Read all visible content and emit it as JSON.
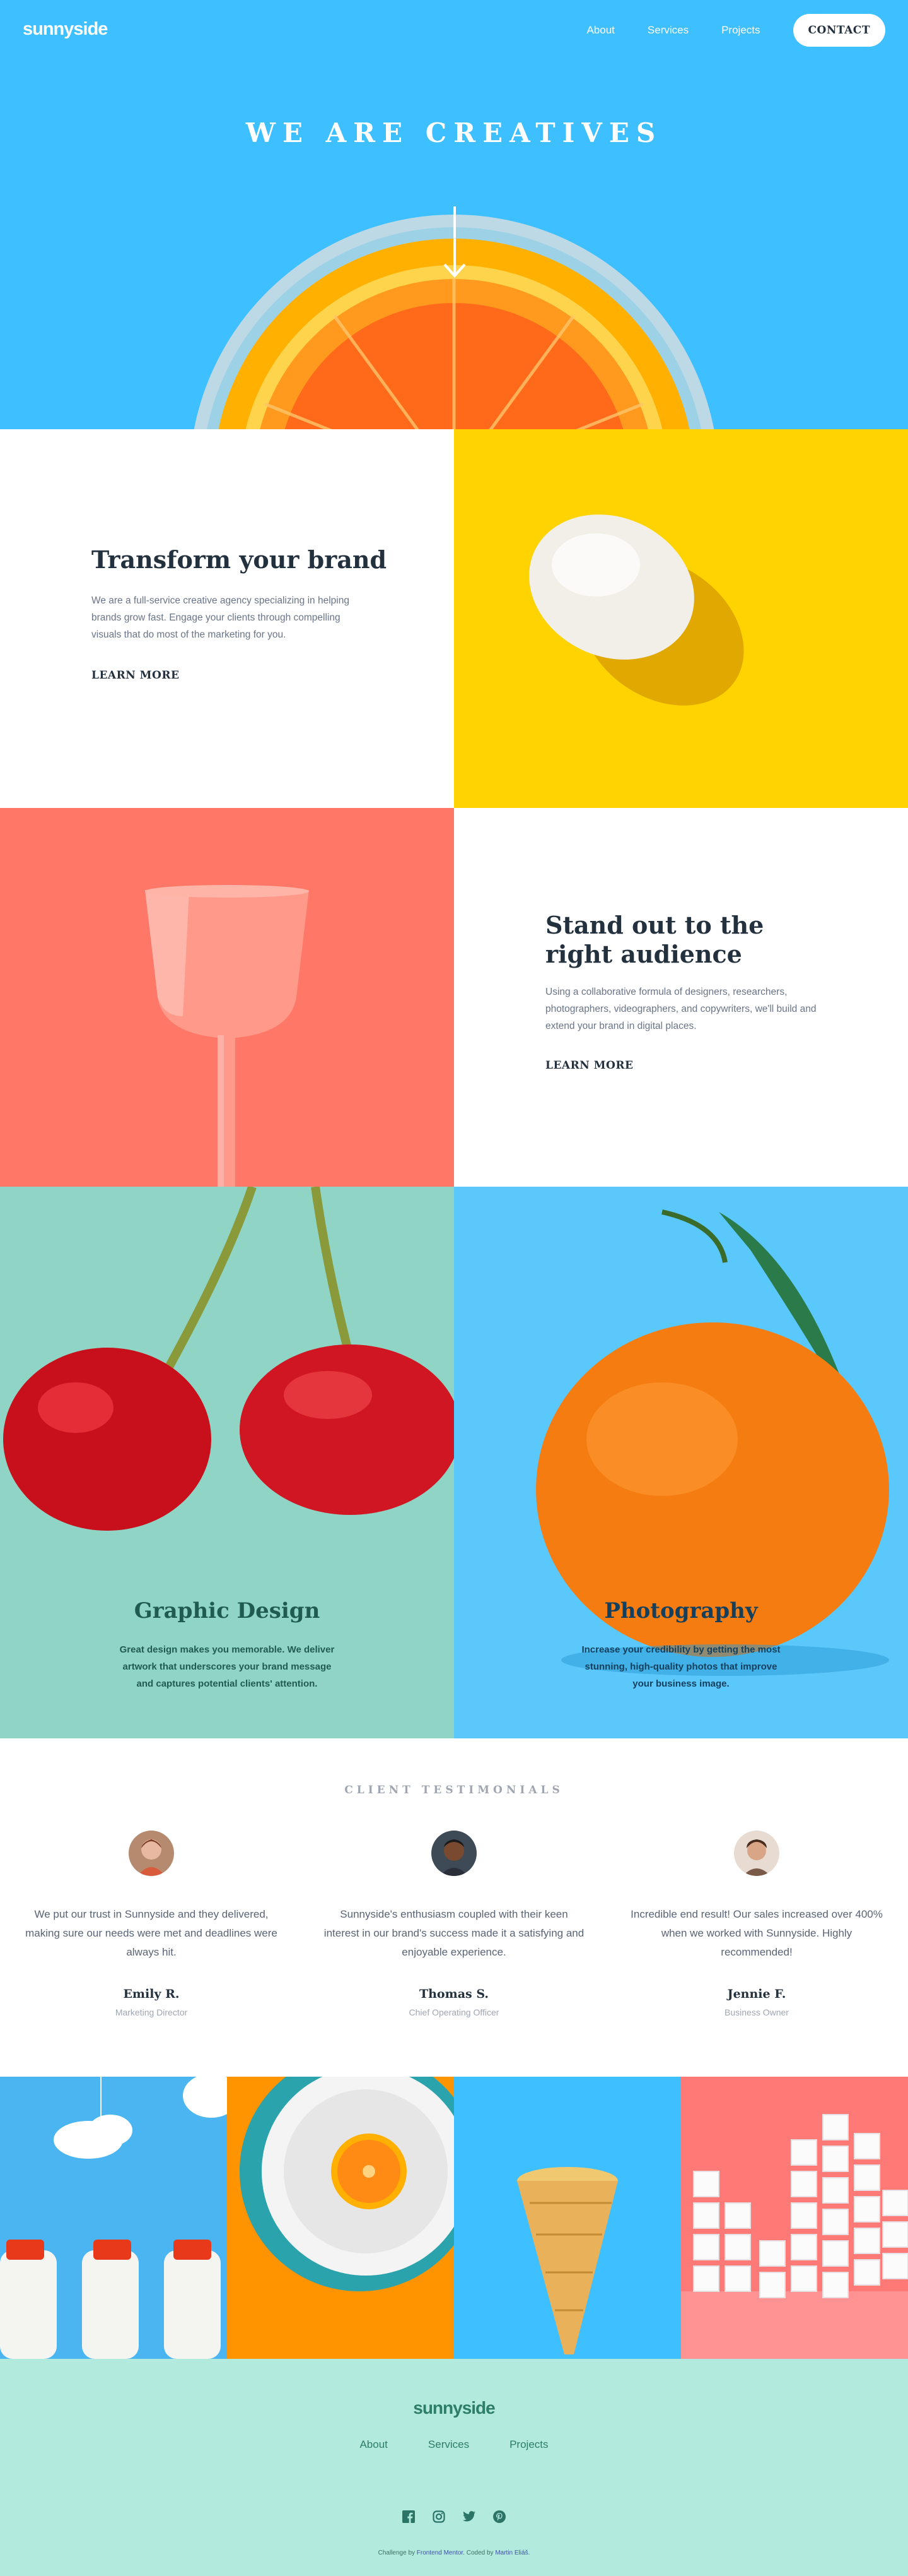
{
  "header": {
    "logo": "sunnyside",
    "nav": [
      "About",
      "Services",
      "Projects"
    ],
    "contact": "CONTACT"
  },
  "hero": {
    "title": "WE ARE CREATIVES"
  },
  "transform": {
    "title": "Transform your brand",
    "body": "We are a full-service creative agency specializing in helping brands grow fast. Engage your clients through compelling visuals that do most of the marketing for you.",
    "link": "LEARN MORE"
  },
  "standout": {
    "title": "Stand out to the right audience",
    "body": "Using a collaborative formula of designers, researchers, photographers, videographers, and copywriters, we'll build and extend your brand in digital places.",
    "link": "LEARN MORE"
  },
  "graphic": {
    "title": "Graphic Design",
    "body": "Great design makes you memorable. We deliver artwork that underscores your brand message and captures potential clients' attention."
  },
  "photo": {
    "title": "Photography",
    "body": "Increase your credibility by getting the most stunning, high-quality photos that improve your business image."
  },
  "testimonials": {
    "label": "CLIENT TESTIMONIALS",
    "items": [
      {
        "quote": "We put our trust in Sunnyside and they delivered, making sure our needs were met and deadlines were always hit.",
        "name": "Emily R.",
        "role": "Marketing Director"
      },
      {
        "quote": "Sunnyside's enthusiasm coupled with their keen interest in our brand's success made it a satisfying and enjoyable experience.",
        "name": "Thomas S.",
        "role": "Chief Operating Officer"
      },
      {
        "quote": "Incredible end result! Our sales increased over 400% when we worked with Sunnyside. Highly recommended!",
        "name": "Jennie F.",
        "role": "Business Owner"
      }
    ]
  },
  "footer": {
    "logo": "sunnyside",
    "nav": [
      "About",
      "Services",
      "Projects"
    ],
    "attribution_prefix": "Challenge by ",
    "attribution_link1": "Frontend Mentor",
    "attribution_mid": ". Coded by ",
    "attribution_link2": "Martin Eliáš",
    "attribution_suffix": ".",
    "social_icons": [
      "facebook-icon",
      "instagram-icon",
      "twitter-icon",
      "pinterest-icon"
    ]
  },
  "colors": {
    "hero_blue": "#3ebfff",
    "yellow": "#ffd300",
    "coral": "#ff7766",
    "teal_bg": "#90d4c5",
    "green_text": "#1f5c4f",
    "blue_text": "#14405e",
    "footer_bg": "#b2ebdd"
  }
}
